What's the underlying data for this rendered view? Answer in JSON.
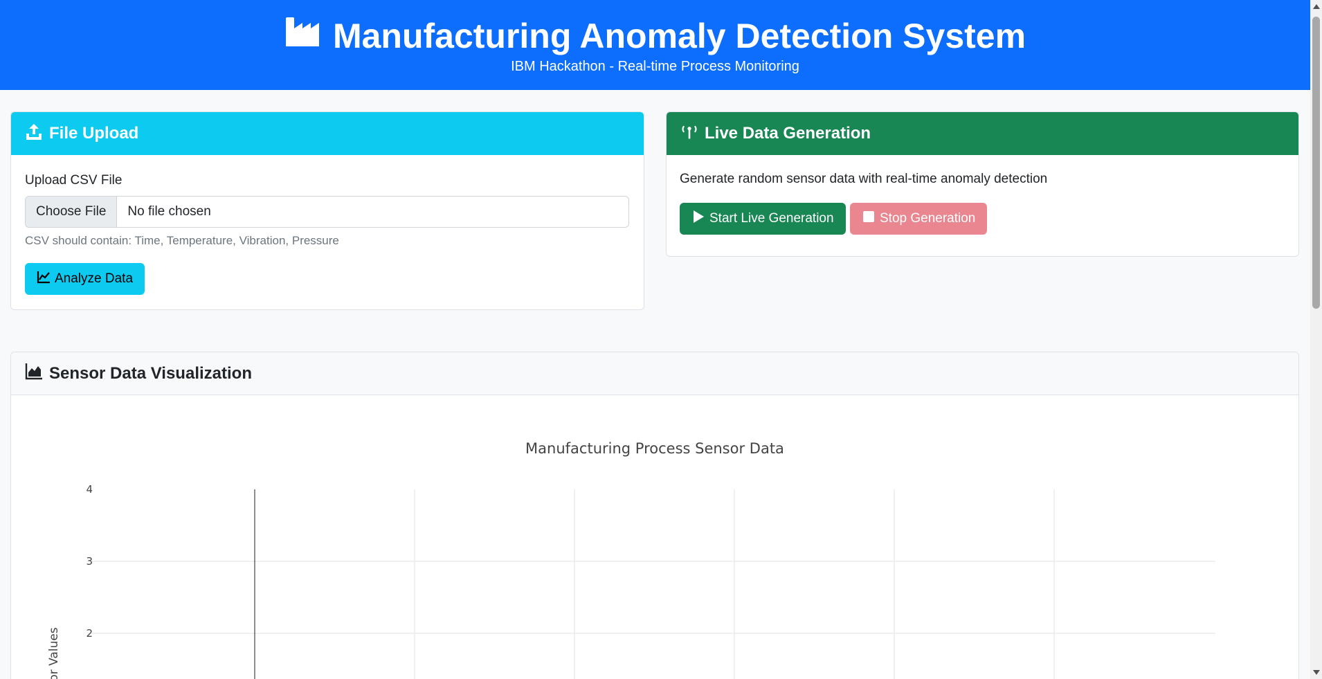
{
  "header": {
    "title": "Manufacturing Anomaly Detection System",
    "subtitle": "IBM Hackathon - Real-time Process Monitoring",
    "icon": "factory-icon"
  },
  "upload": {
    "title": "File Upload",
    "icon": "upload-icon",
    "label": "Upload CSV File",
    "choose_label": "Choose File",
    "file_status": "No file chosen",
    "help": "CSV should contain: Time, Temperature, Vibration, Pressure",
    "analyze_label": "Analyze Data",
    "analyze_icon": "line-chart-icon"
  },
  "live": {
    "title": "Live Data Generation",
    "icon": "broadcast-tower-icon",
    "description": "Generate random sensor data with real-time anomaly detection",
    "start_label": "Start Live Generation",
    "start_icon": "play-icon",
    "stop_label": "Stop Generation",
    "stop_icon": "stop-icon"
  },
  "viz": {
    "title": "Sensor Data Visualization",
    "icon": "area-chart-icon"
  },
  "chart_data": {
    "type": "line",
    "title": "Manufacturing Process Sensor Data",
    "xlabel": "",
    "ylabel": "Sensor Values",
    "y_ticks": [
      4,
      3,
      2
    ],
    "series": [],
    "grid": true
  },
  "colors": {
    "primary": "#0d6efd",
    "info": "#0dcaf0",
    "success": "#198754",
    "danger_disabled": "#ea868f"
  }
}
